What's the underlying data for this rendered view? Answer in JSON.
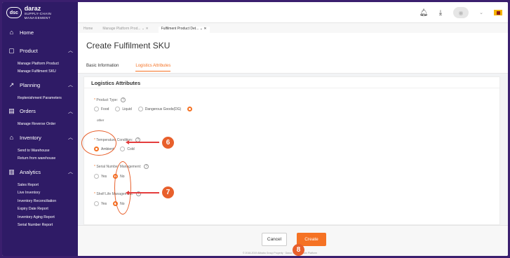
{
  "brand": {
    "name": "daraz",
    "tagline": "SUPPLY-CHAIN MANAGEMENT",
    "mark": "dsc"
  },
  "sidebar": {
    "home": "Home",
    "product": {
      "label": "Product",
      "items": [
        "Manage Platform Product",
        "Manage Fulfilment SKU"
      ]
    },
    "planning": {
      "label": "Planning",
      "items": [
        "Replenishment Parameters"
      ]
    },
    "orders": {
      "label": "Orders",
      "items": [
        "Manage Reverse Order"
      ]
    },
    "inventory": {
      "label": "Inventory",
      "items": [
        "Send to Warehouse",
        "Return from warehouse"
      ]
    },
    "analytics": {
      "label": "Analytics",
      "items": [
        "Sales Report",
        "Live Inventory",
        "Inventory Reconciliation",
        "Expiry Date Report",
        "Inventory Aging Report",
        "Serial Number Report"
      ]
    }
  },
  "tabs": [
    "Home",
    "Manage Platform Prod...",
    "Fulfilment Product Det..."
  ],
  "page_title": "Create Fulfilment SKU",
  "subtabs": {
    "basic": "Basic Information",
    "logistics": "Logistics Attributes"
  },
  "section_title": "Logistics Attributes",
  "product_type": {
    "label": "Product Type:",
    "options": [
      "Food",
      "Liquid",
      "Dangerous Goods(DG)",
      ""
    ],
    "other": "other"
  },
  "temperature": {
    "label": "Temperature Condition:",
    "options": [
      "Ambient",
      "Cold"
    ]
  },
  "serial": {
    "label": "Serial Number Management:",
    "options": [
      "Yes",
      "No"
    ]
  },
  "shelf": {
    "label": "Shelf Life Management:",
    "options": [
      "Yes",
      "No"
    ]
  },
  "buttons": {
    "cancel": "Cancel",
    "create": "Create"
  },
  "copyright": "© 2018-2019 Alibaba Group Property · Daraz Supply Chain Platform",
  "annotations": {
    "b6": "6",
    "b7": "7",
    "b8": "8"
  },
  "colors": {
    "accent": "#f57224",
    "sidebar": "#2f1b66",
    "annotation": "#e8602c"
  }
}
